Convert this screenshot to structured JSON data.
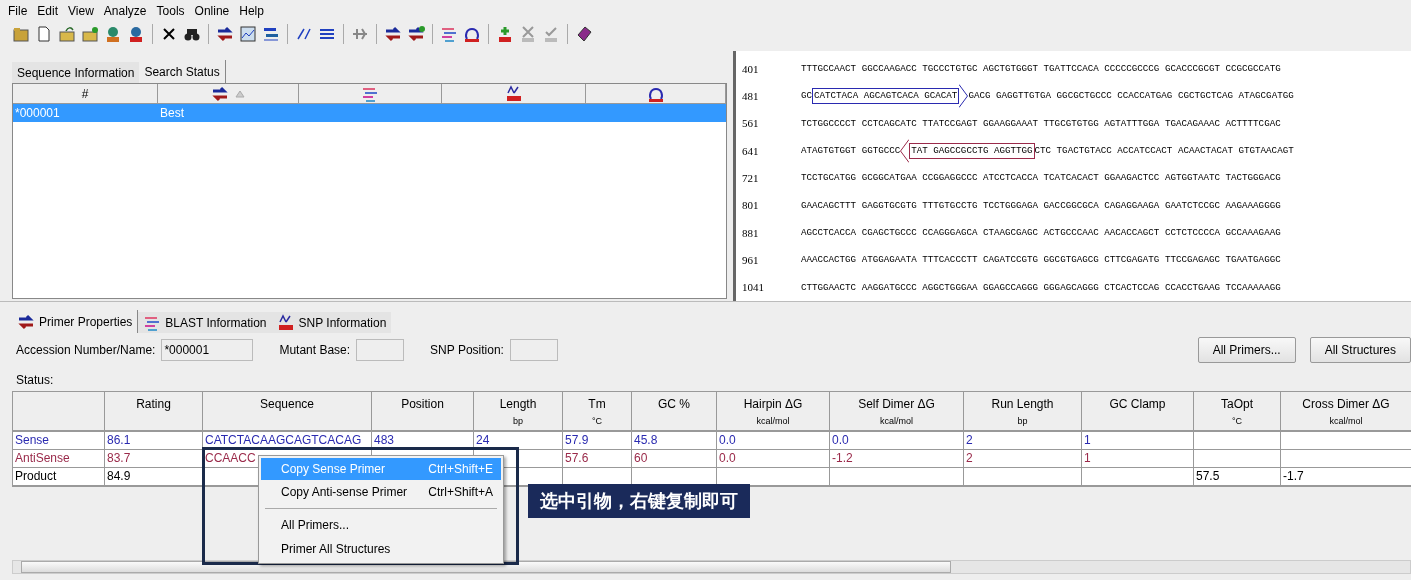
{
  "menu_bar": [
    "File",
    "Edit",
    "View",
    "Analyze",
    "Tools",
    "Online",
    "Help"
  ],
  "upper_tabs": [
    {
      "label": "Sequence Information",
      "selected": false
    },
    {
      "label": "Search Status",
      "selected": true
    }
  ],
  "search_table": {
    "columns": [
      {
        "kind": "text",
        "label": "#"
      },
      {
        "kind": "primer"
      },
      {
        "kind": "blast"
      },
      {
        "kind": "snp"
      },
      {
        "kind": "structure"
      }
    ],
    "rows": [
      {
        "cells": [
          "*000001",
          "Best"
        ],
        "selected": true
      }
    ]
  },
  "sequence": [
    {
      "number": "401",
      "segments": [
        {
          "kind": "plain",
          "text": "TTTGCCAACT GGCCAAGACC TGCCCTGTGC AGCTGTGGGT TGATTCCACA CCCCCGCCCG GCACCCGCGT CCGCGCCATG"
        }
      ]
    },
    {
      "number": "481",
      "segments": [
        {
          "kind": "plain",
          "text": "GC"
        },
        {
          "kind": "sense",
          "text": "CATCTACA AGCAGTCACA GCACAT"
        },
        {
          "kind": "plain",
          "text": "GACG GAGGTTGTGA GGCGCTGCCC CCACCATGAG CGCTGCTCAG ATAGCGATGG"
        }
      ]
    },
    {
      "number": "561",
      "segments": [
        {
          "kind": "plain",
          "text": "TCTGGCCCCT CCTCAGCATC TTATCCGAGT GGAAGGAAAT TTGCGTGTGG AGTATTTGGA TGACAGAAAC ACTTTTCGAC"
        }
      ]
    },
    {
      "number": "641",
      "segments": [
        {
          "kind": "plain",
          "text": "ATAGTGTGGT GGTGCCC"
        },
        {
          "kind": "antisense",
          "text": "TAT GAGCCGCCTG AGGTTGG"
        },
        {
          "kind": "plain",
          "text": "CTC TGACTGTACC ACCATCCACT ACAACTACAT GTGTAACAGT"
        }
      ]
    },
    {
      "number": "721",
      "segments": [
        {
          "kind": "plain",
          "text": "TCCTGCATGG GCGGCATGAA CCGGAGGCCC ATCCTCACCA TCATCACACT GGAAGACTCC AGTGGTAATC TACTGGGACG"
        }
      ]
    },
    {
      "number": "801",
      "segments": [
        {
          "kind": "plain",
          "text": "GAACAGCTTT GAGGTGCGTG TTTGTGCCTG TCCTGGGAGA GACCGGCGCA CAGAGGAAGA GAATCTCCGC AAGAAAGGGG"
        }
      ]
    },
    {
      "number": "881",
      "segments": [
        {
          "kind": "plain",
          "text": "AGCCTCACCA CGAGCTGCCC CCAGGGAGCA CTAAGCGAGC ACTGCCCAAC AACACCAGCT CCTCTCCCCA GCCAAAGAAG"
        }
      ]
    },
    {
      "number": "961",
      "segments": [
        {
          "kind": "plain",
          "text": "AAACCACTGG ATGGAGAATA TTTCACCCTT CAGATCCGTG GGCGTGAGCG CTTCGAGATG TTCCGAGAGC TGAATGAGGC"
        }
      ]
    },
    {
      "number": "1041",
      "segments": [
        {
          "kind": "plain",
          "text": "CTTGGAACTC AAGGATGCCC AGGCTGGGAA GGAGCCAGGG GGGAGCAGGG CTCACTCCAG CCACCTGAAG TCCAAAAAGG"
        }
      ]
    }
  ],
  "lower_tabs": [
    {
      "label": "Primer Properties",
      "kind": "primer",
      "selected": true
    },
    {
      "label": "BLAST Information",
      "kind": "blast",
      "selected": false
    },
    {
      "label": "SNP Information",
      "kind": "snp",
      "selected": false
    }
  ],
  "fields": [
    {
      "label": "Accession Number/Name:",
      "value": "*000001",
      "kind": "wide"
    },
    {
      "label": "Mutant Base:",
      "kind": "narrow"
    },
    {
      "label": "SNP Position:",
      "kind": "narrow"
    }
  ],
  "buttons": [
    "All Primers...",
    "All Structures"
  ],
  "status_label": "Status:",
  "primer_table": {
    "columns": [
      {},
      {
        "label": "Rating"
      },
      {
        "label": "Sequence"
      },
      {
        "label": "Position"
      },
      {
        "label": "Length",
        "unit": "bp"
      },
      {
        "label": "Tm",
        "unit": "°C"
      },
      {
        "label": "GC %"
      },
      {
        "label": "Hairpin ΔG",
        "unit": "kcal/mol"
      },
      {
        "label": "Self Dimer ΔG",
        "unit": "kcal/mol"
      },
      {
        "label": "Run Length",
        "unit": "bp"
      },
      {
        "label": "GC Clamp"
      },
      {
        "label": "TaOpt",
        "unit": "°C"
      },
      {
        "label": "Cross Dimer ΔG",
        "unit": "kcal/mol"
      }
    ],
    "rows": [
      {
        "kind": "sense",
        "cells": [
          "Sense",
          "86.1",
          "CATCTACAAGCAGTCACAG",
          "483",
          "24",
          "57.9",
          "45.8",
          "0.0",
          "0.0",
          "2",
          "1",
          "",
          ""
        ]
      },
      {
        "kind": "antisense",
        "cells": [
          "AntiSense",
          "83.7",
          "CCAACC",
          "",
          "",
          "57.6",
          "60",
          "0.0",
          "-1.2",
          "2",
          "1",
          "",
          ""
        ]
      },
      {
        "kind": "product",
        "cells": [
          "Product",
          "84.9",
          "",
          "",
          "",
          "",
          "",
          "",
          "",
          "",
          "",
          "57.5",
          "-1.7"
        ]
      }
    ]
  },
  "context_menu": [
    {
      "kind": "item",
      "label": "Copy Sense Primer",
      "shortcut": "Ctrl+Shift+E",
      "selected": true
    },
    {
      "kind": "item",
      "label": "Copy Anti-sense Primer",
      "shortcut": "Ctrl+Shift+A",
      "selected": false
    },
    {
      "kind": "separator"
    },
    {
      "kind": "item",
      "label": "All Primers...",
      "selected": false
    },
    {
      "kind": "item",
      "label": "Primer All Structures",
      "selected": false
    }
  ],
  "callout": "选中引物，右键复制即可"
}
